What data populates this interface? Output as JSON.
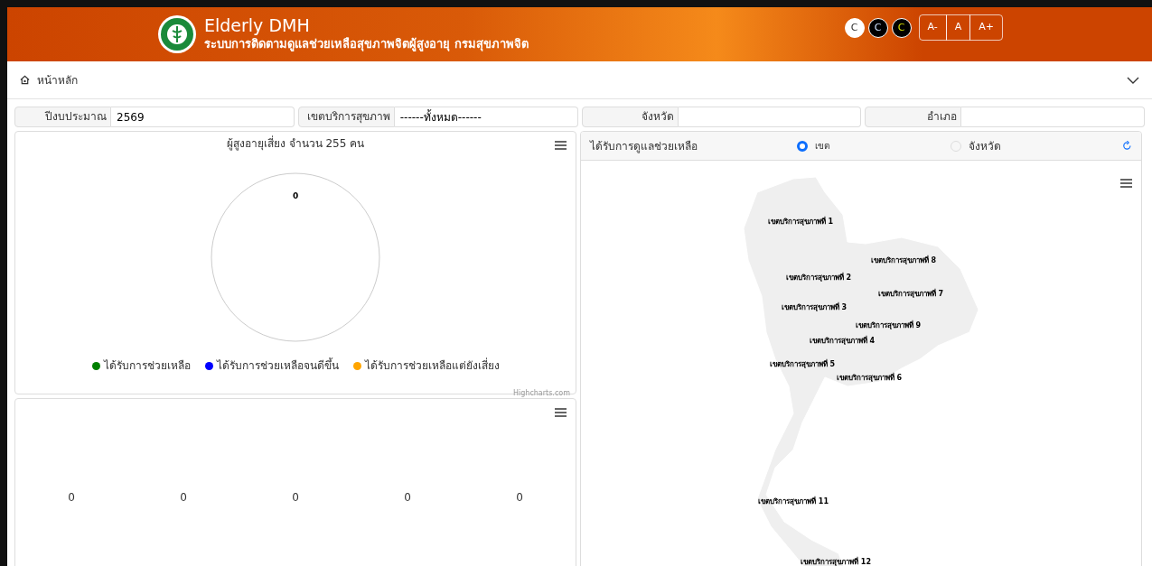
{
  "header": {
    "title": "Elderly DMH",
    "subtitle": "ระบบการติดตามดูแลช่วยเหลือสุขภาพจิตผู้สูงอายุ กรมสุขภาพจิต",
    "contrast_buttons": [
      {
        "label": "C",
        "kind": "light"
      },
      {
        "label": "C",
        "kind": "dark"
      },
      {
        "label": "C",
        "kind": "yellow"
      }
    ],
    "font_buttons": [
      "A-",
      "A",
      "A+"
    ]
  },
  "breadcrumb": {
    "label": "หน้าหลัก",
    "expanded": false
  },
  "filters": [
    {
      "label": "ปีงบประมาณ",
      "value": "2569"
    },
    {
      "label": "เขตบริการสุขภาพ",
      "value": "------ทั้งหมด------"
    },
    {
      "label": "จังหวัด"
    },
    {
      "label": "อำเภอ"
    }
  ],
  "pie_chart": {
    "title": "ผู้สูงอายุเสี่ยง จำนวน 255 คน",
    "data_label": "0",
    "legend": [
      {
        "label": "ได้รับการช่วยเหลือ",
        "color": "#008000"
      },
      {
        "label": "ได้รับการช่วยเหลือจนดีขึ้น",
        "color": "#0000ff"
      },
      {
        "label": "ได้รับการช่วยเหลือแต่ยังเสี่ยง",
        "color": "#ffa500"
      }
    ],
    "credits": "Highcharts.com"
  },
  "bar_chart": {
    "value_labels": [
      "0",
      "0",
      "0",
      "0",
      "0"
    ]
  },
  "map_panel": {
    "title": "ได้รับการดูแลช่วยเหลือ",
    "options": [
      {
        "label": "เขต",
        "selected": true
      },
      {
        "label": "จังหวัด",
        "selected": false
      }
    ],
    "regions": [
      "เขตบริการสุขภาพที่ 1",
      "เขตบริการสุขภาพที่ 8",
      "เขตบริการสุขภาพที่ 2",
      "เขตบริการสุขภาพที่ 7",
      "เขตบริการสุขภาพที่ 3",
      "เขตบริการสุขภาพที่ 9",
      "เขตบริการสุขภาพที่ 4",
      "เขตบริการสุขภาพที่ 5",
      "เขตบริการสุขภาพที่ 6",
      "เขตบริการสุขภาพที่ 11",
      "เขตบริการสุขภาพที่ 12"
    ]
  }
}
